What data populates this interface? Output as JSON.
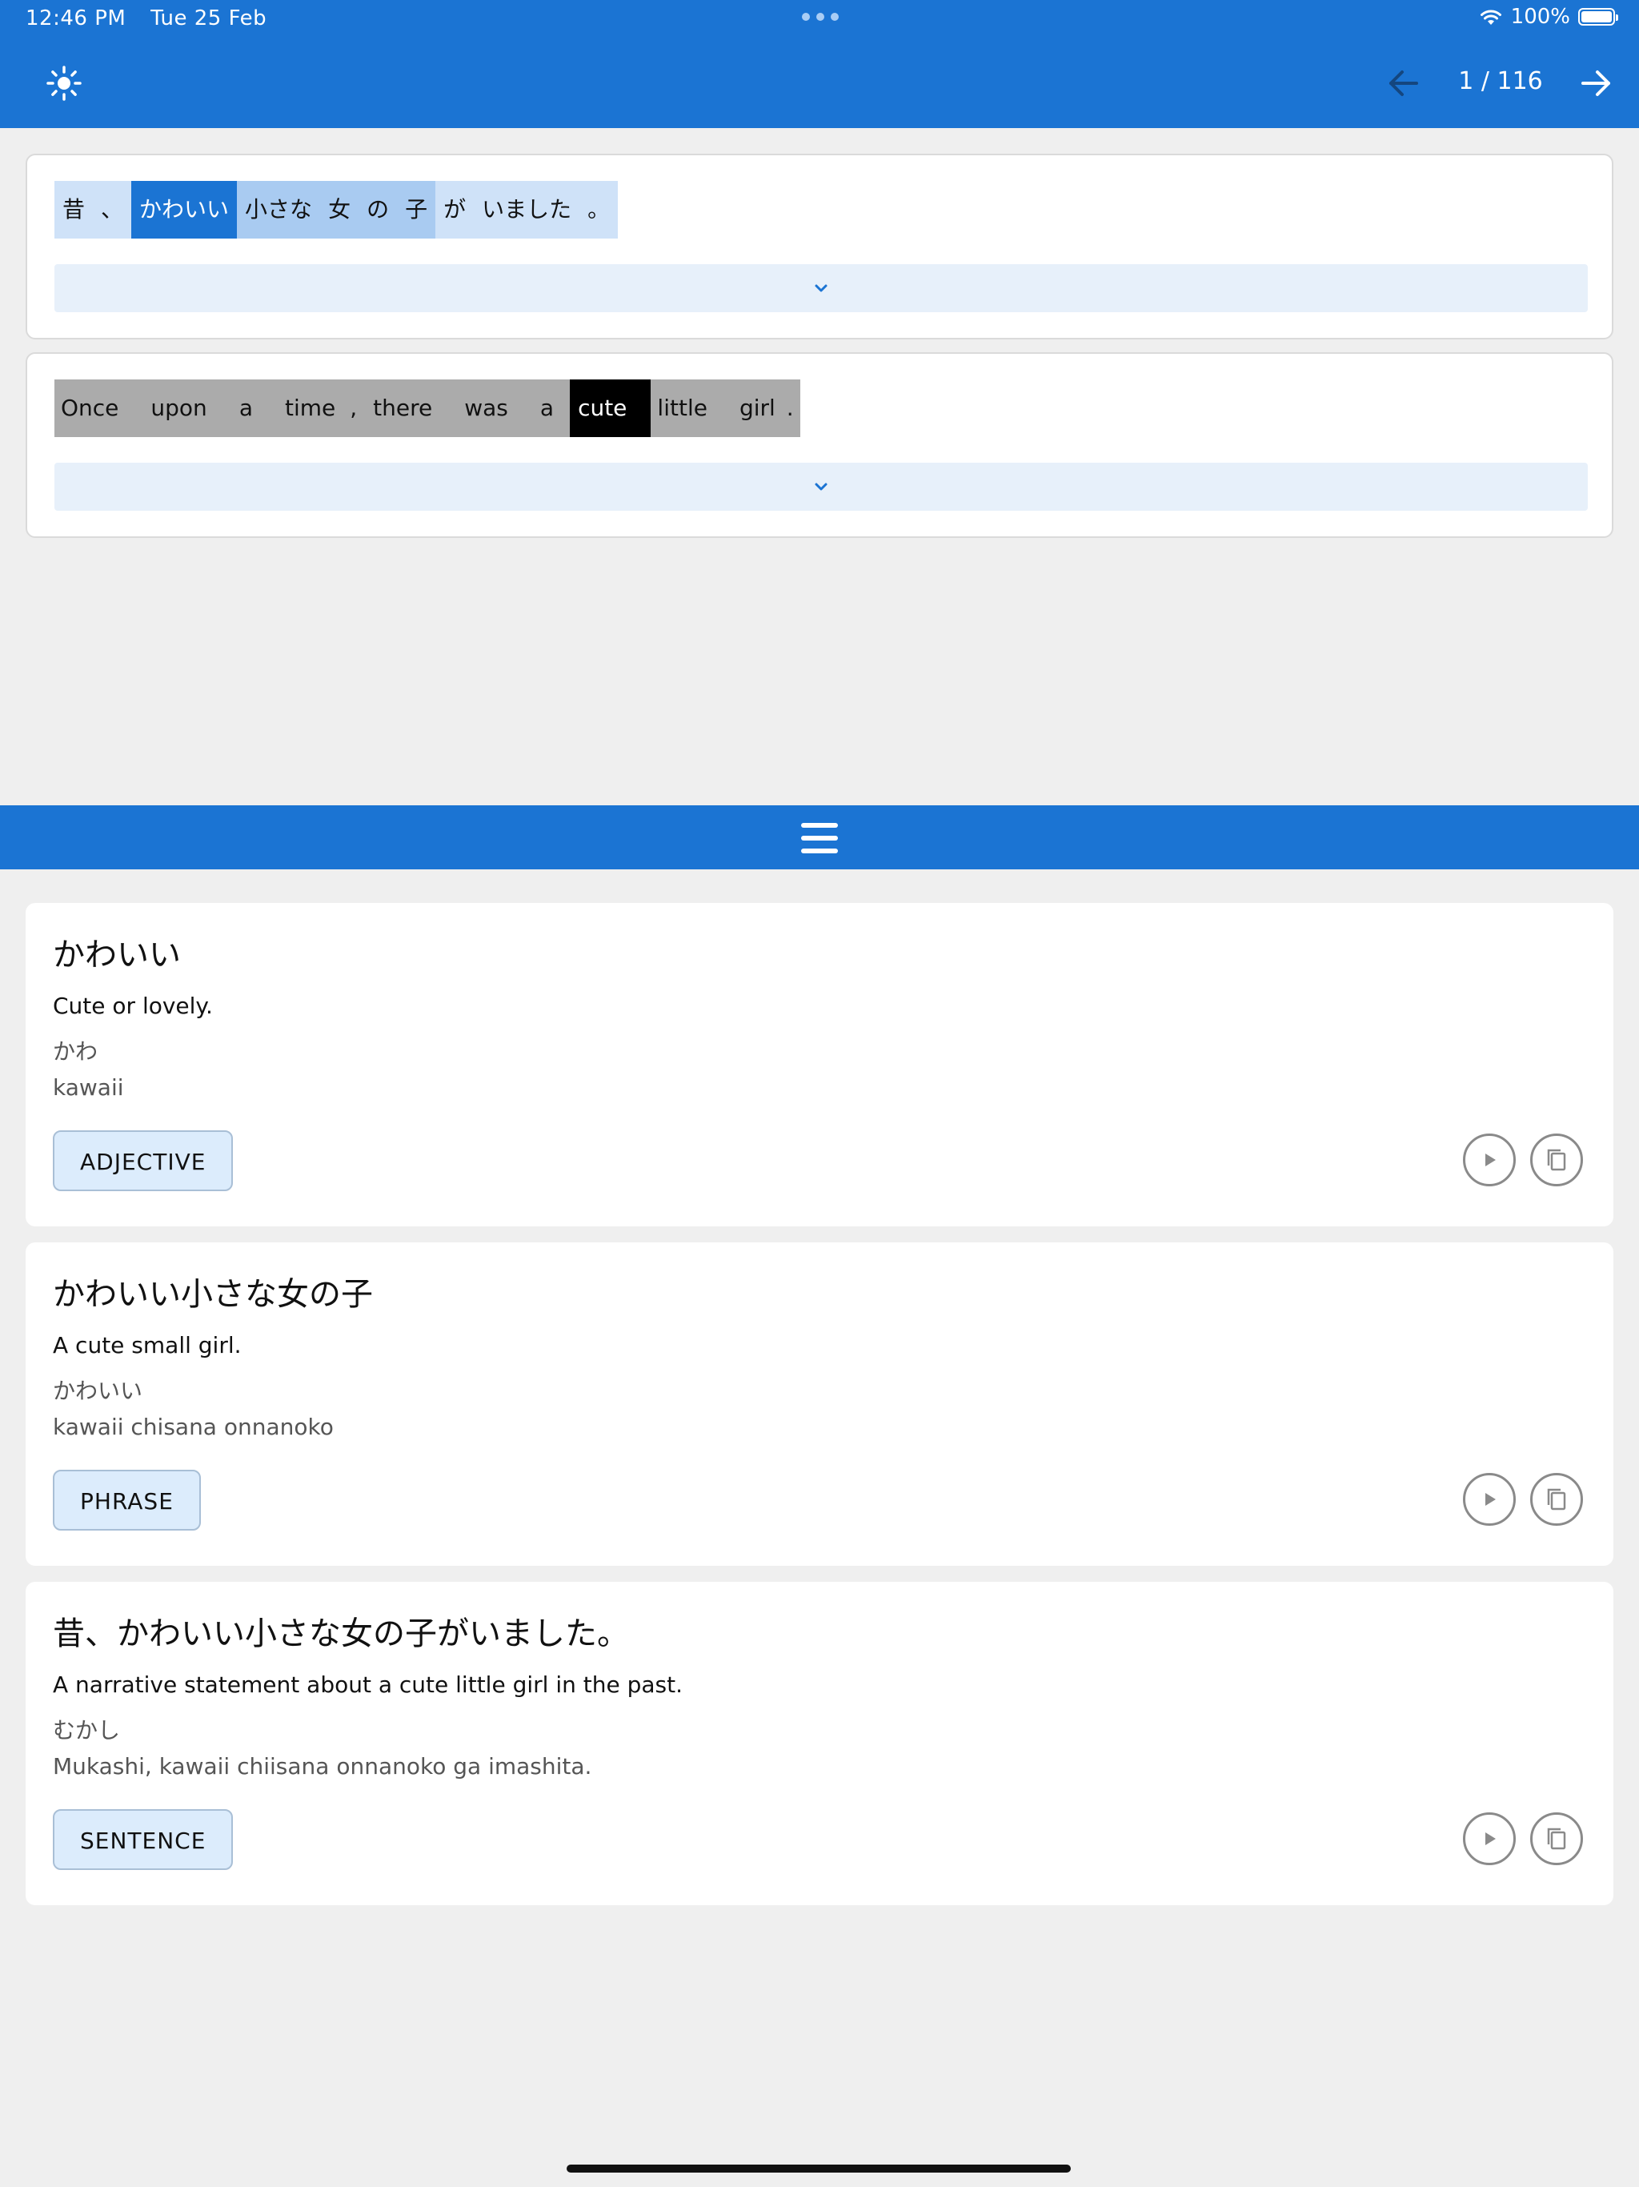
{
  "status_bar": {
    "time": "12:46 PM",
    "date": "Tue 25 Feb",
    "battery": "100%"
  },
  "header": {
    "theme_icon": "sun-icon",
    "prev_icon": "arrow-left-icon",
    "next_icon": "arrow-right-icon",
    "page_counter": "1 / 116"
  },
  "source_sentence": {
    "tokens": [
      {
        "text": "昔",
        "state": "normal"
      },
      {
        "text": "、",
        "state": "normal"
      },
      {
        "text": "かわいい",
        "state": "selected"
      },
      {
        "text": "小さな",
        "state": "phrase"
      },
      {
        "text": "女",
        "state": "phrase"
      },
      {
        "text": "の",
        "state": "phrase"
      },
      {
        "text": "子",
        "state": "phrase"
      },
      {
        "text": "が",
        "state": "normal"
      },
      {
        "text": "いました",
        "state": "normal"
      },
      {
        "text": "。",
        "state": "normal"
      }
    ]
  },
  "translation_sentence": {
    "tokens": [
      {
        "text": "Once",
        "state": "normal"
      },
      {
        "text": "upon",
        "state": "normal"
      },
      {
        "text": "a",
        "state": "normal"
      },
      {
        "text": "time",
        "state": "normal"
      },
      {
        "text": ",",
        "state": "normal"
      },
      {
        "text": "there",
        "state": "normal"
      },
      {
        "text": "was",
        "state": "normal"
      },
      {
        "text": "a",
        "state": "normal"
      },
      {
        "text": "cute",
        "state": "selected"
      },
      {
        "text": "little",
        "state": "normal"
      },
      {
        "text": "girl",
        "state": "normal"
      },
      {
        "text": ".",
        "state": "normal"
      }
    ]
  },
  "entries": [
    {
      "title": "かわいい",
      "meaning": "Cute or lovely.",
      "reading": "かわ",
      "romaji": "kawaii",
      "tag": "ADJECTIVE"
    },
    {
      "title": "かわいい小さな女の子",
      "meaning": "A cute small girl.",
      "reading": "かわいい",
      "romaji": "kawaii chisana onnanoko",
      "tag": "PHRASE"
    },
    {
      "title": "昔、かわいい小さな女の子がいました。",
      "meaning": "A narrative statement about a cute little girl in the past.",
      "reading": "むかし",
      "romaji": "Mukashi, kawaii chiisana onnanoko ga imashita.",
      "tag": "SENTENCE"
    }
  ],
  "colors": {
    "accent": "#1b74d3",
    "token_bg": "#cfe2f8",
    "token_phrase": "#a9cbf1",
    "en_token_bg": "#ababab",
    "tag_bg": "#dcecfc"
  }
}
